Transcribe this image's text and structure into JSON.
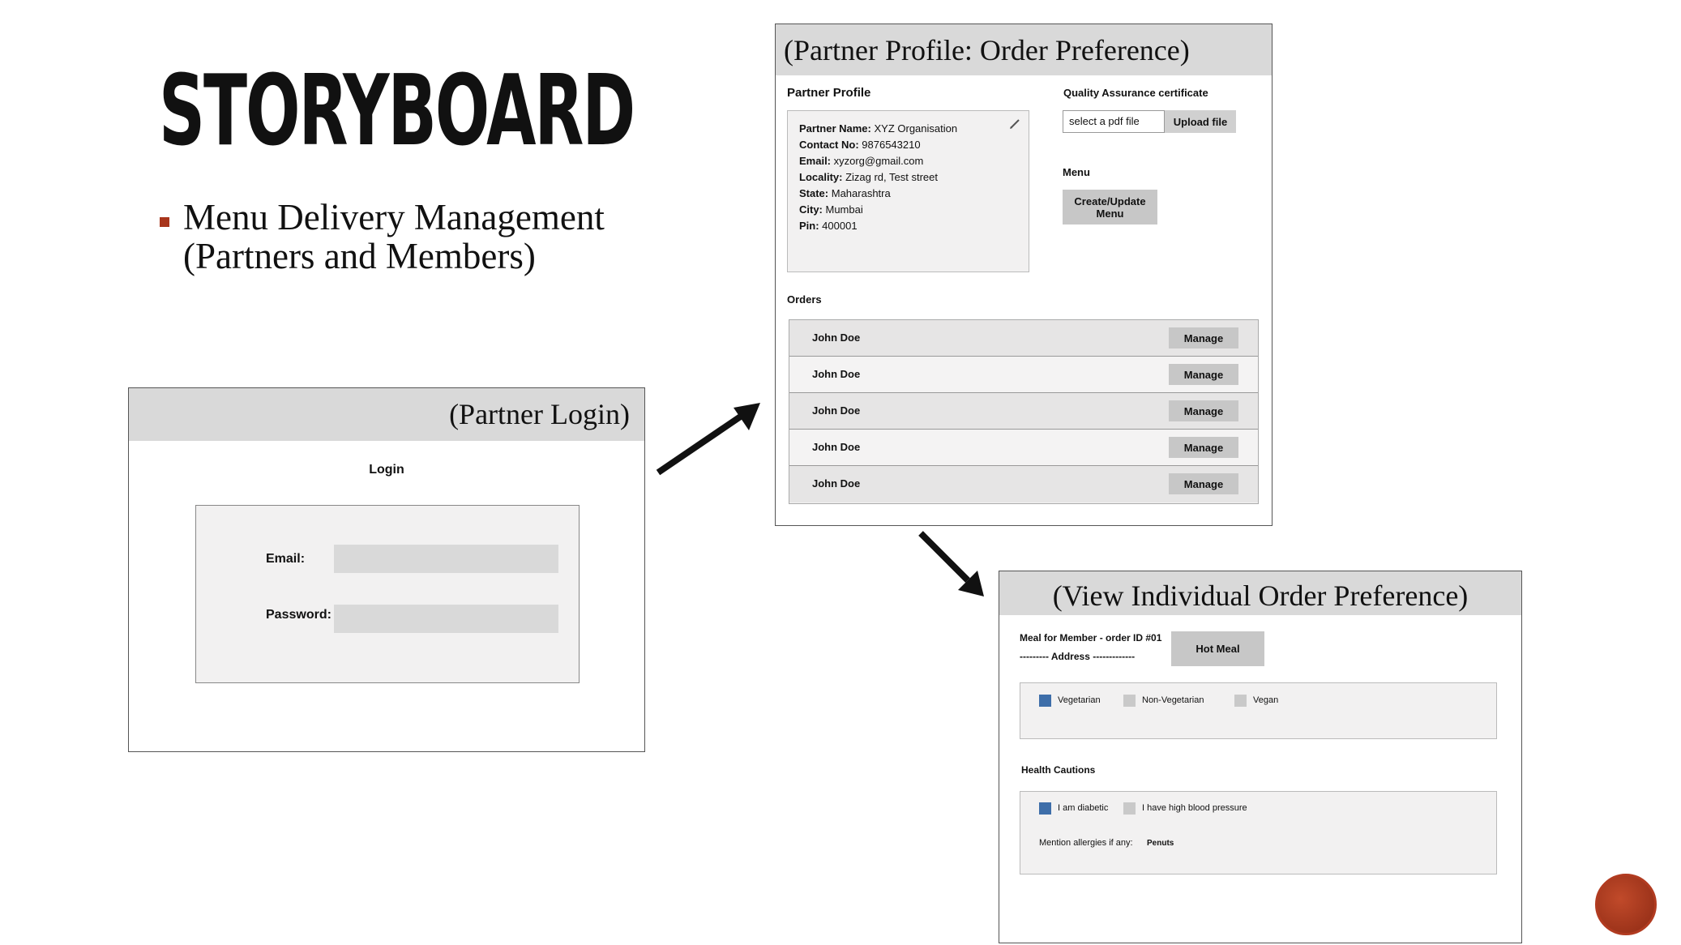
{
  "slide": {
    "title": "STORYBOARD",
    "bullet_line1": "Menu Delivery Management",
    "bullet_line2": "(Partners and Members)"
  },
  "login": {
    "header": "(Partner Login)",
    "heading": "Login",
    "email_label": "Email:",
    "password_label": "Password:"
  },
  "profile": {
    "header": "(Partner Profile: Order Preference)",
    "section_title": "Partner Profile",
    "info": [
      {
        "label": "Partner Name:",
        "value": " XYZ Organisation"
      },
      {
        "label": "Contact No:",
        "value": " 9876543210"
      },
      {
        "label": "Email:",
        "value": " xyzorg@gmail.com"
      },
      {
        "label": "Locality:",
        "value": " Zizag rd, Test street"
      },
      {
        "label": "State:",
        "value": " Maharashtra"
      },
      {
        "label": "City:",
        "value": " Mumbai"
      },
      {
        "label": "Pin:",
        "value": " 400001"
      }
    ],
    "qa_title": "Quality Assurance certificate",
    "file_placeholder": "select a pdf file",
    "upload_label": "Upload file",
    "menu_title": "Menu",
    "menu_button_line1": "Create/Update",
    "menu_button_line2": "Menu",
    "orders_title": "Orders",
    "orders": [
      {
        "name": "John Doe",
        "action": "Manage"
      },
      {
        "name": "John Doe",
        "action": "Manage"
      },
      {
        "name": "John Doe",
        "action": "Manage"
      },
      {
        "name": "John Doe",
        "action": "Manage"
      },
      {
        "name": "John Doe",
        "action": "Manage"
      }
    ]
  },
  "view": {
    "header": "(View Individual Order Preference)",
    "meal_title": "Meal for Member - order ID #01",
    "address": "--------- Address -------------",
    "meal_type": "Hot Meal",
    "diet_options": [
      {
        "label": "Vegetarian",
        "checked": true
      },
      {
        "label": "Non-Vegetarian",
        "checked": false
      },
      {
        "label": "Vegan",
        "checked": false
      }
    ],
    "health_title": "Health Cautions",
    "health_options": [
      {
        "label": "I am diabetic",
        "checked": true
      },
      {
        "label": "I have high blood pressure",
        "checked": false
      }
    ],
    "allergy_label": "Mention allergies if any:",
    "allergy_value": "Penuts"
  },
  "colors": {
    "accent": "#a8351c",
    "checked": "#3e6ea9",
    "unchecked": "#c9c9c9",
    "header_bg": "#d9d9d9"
  }
}
